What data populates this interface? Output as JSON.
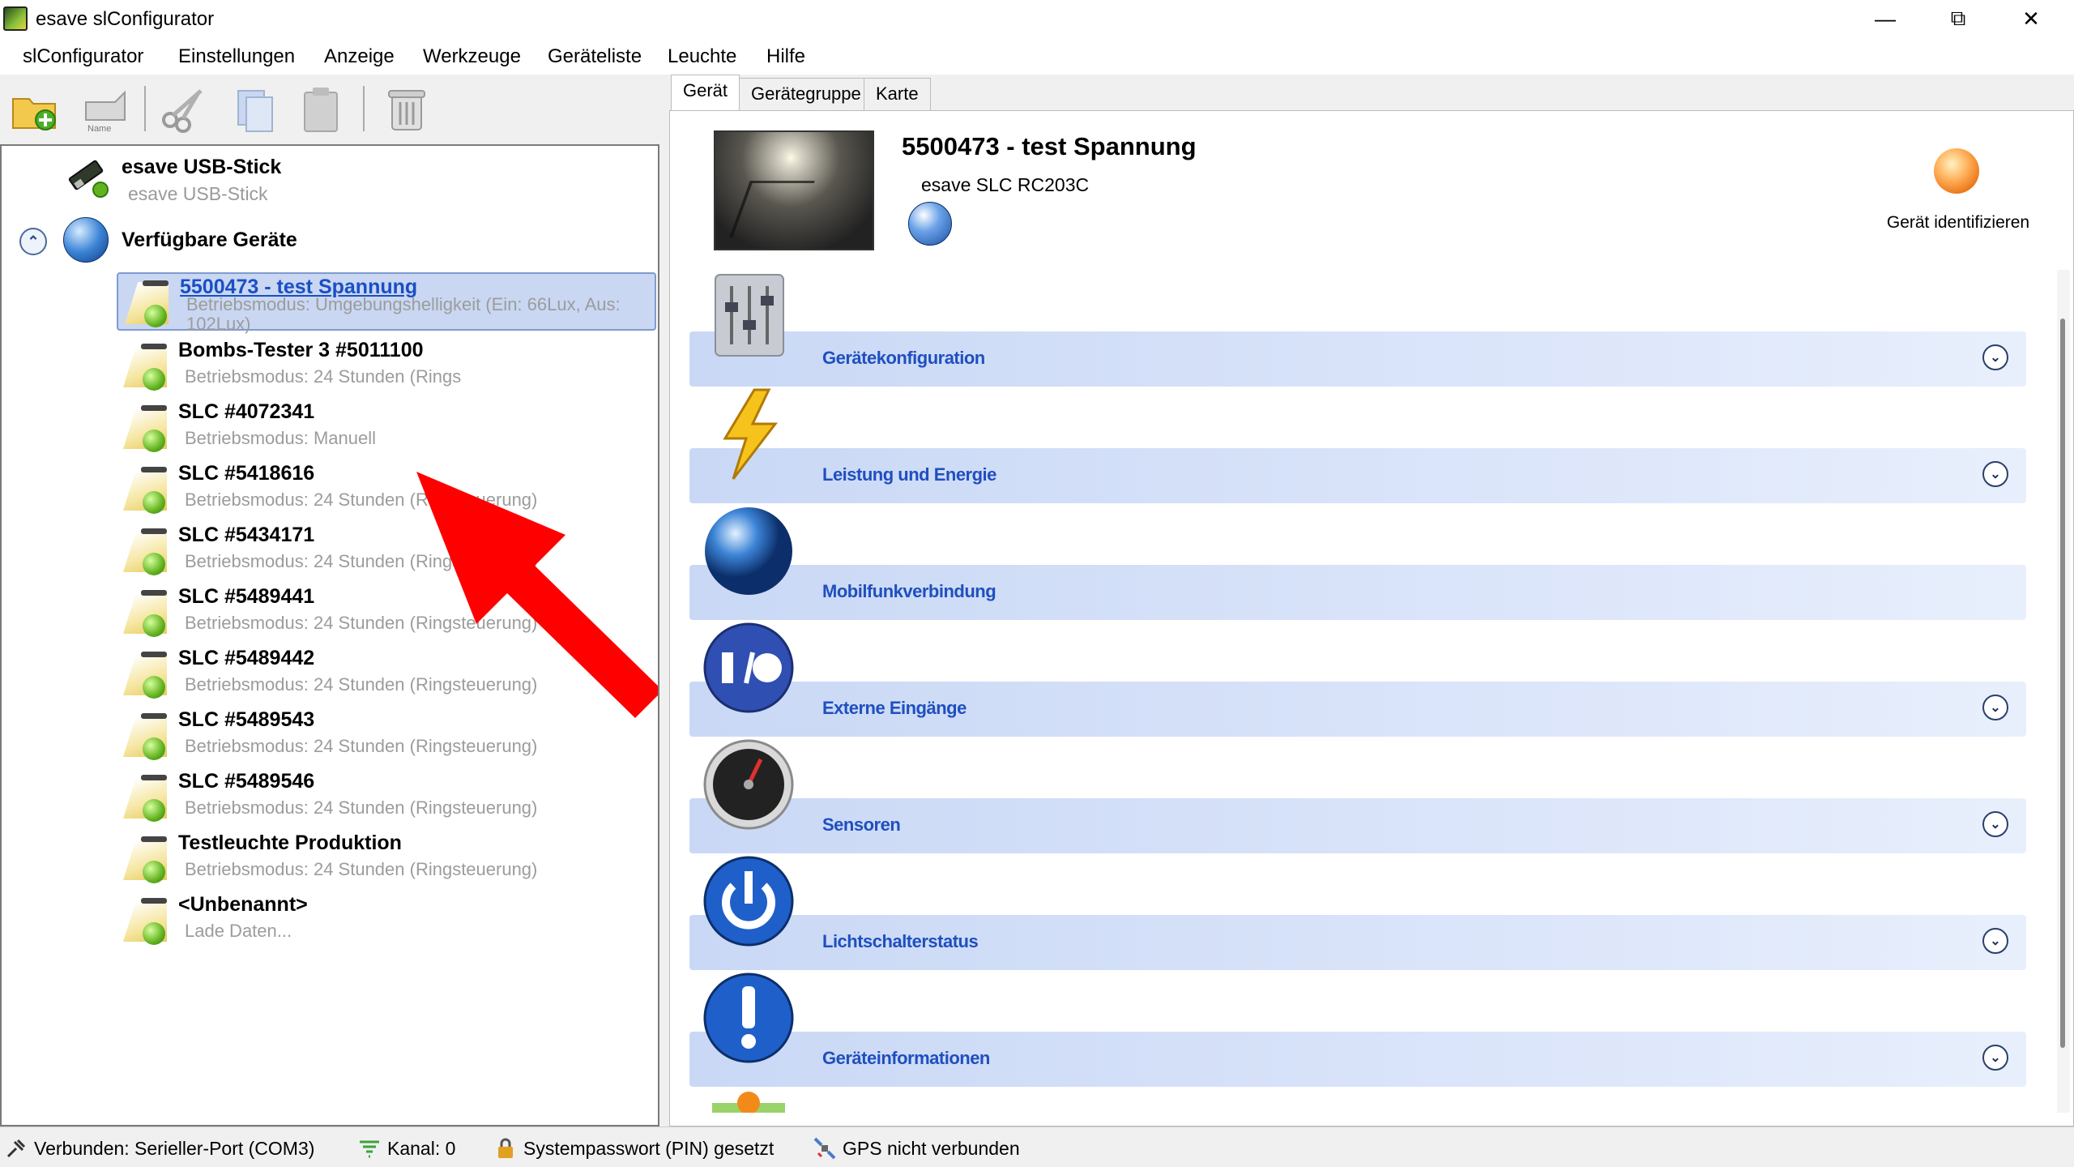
{
  "window": {
    "title": "esave slConfigurator"
  },
  "menu": [
    "slConfigurator",
    "Einstellungen",
    "Anzeige",
    "Werkzeuge",
    "Geräteliste",
    "Leuchte",
    "Hilfe"
  ],
  "toolbar": {
    "rename_label": "Name"
  },
  "tree": {
    "usb": {
      "title": "esave USB-Stick",
      "subtitle": "esave USB-Stick"
    },
    "available": {
      "title": "Verfügbare Geräte"
    },
    "devices": [
      {
        "title": "5500473 - test Spannung",
        "subtitle": "Betriebsmodus: Umgebungshelligkeit (Ein: 66Lux, Aus: 102Lux)",
        "selected": true
      },
      {
        "title": "Bombs-Tester 3 #5011100",
        "subtitle": "Betriebsmodus: 24 Stunden (Rings"
      },
      {
        "title": "SLC #4072341",
        "subtitle": "Betriebsmodus: Manuell"
      },
      {
        "title": "SLC #5418616",
        "subtitle": "Betriebsmodus: 24 Stunden (Ringsteuerung)"
      },
      {
        "title": "SLC #5434171",
        "subtitle": "Betriebsmodus: 24 Stunden (Ringsteuerung)"
      },
      {
        "title": "SLC #5489441",
        "subtitle": "Betriebsmodus: 24 Stunden (Ringsteuerung)"
      },
      {
        "title": "SLC #5489442",
        "subtitle": "Betriebsmodus: 24 Stunden (Ringsteuerung)"
      },
      {
        "title": "SLC #5489543",
        "subtitle": "Betriebsmodus: 24 Stunden (Ringsteuerung)"
      },
      {
        "title": "SLC #5489546",
        "subtitle": "Betriebsmodus: 24 Stunden (Ringsteuerung)"
      },
      {
        "title": "Testleuchte Produktion",
        "subtitle": "Betriebsmodus: 24 Stunden (Ringsteuerung)"
      },
      {
        "title": "<Unbenannt>",
        "subtitle": "Lade Daten..."
      }
    ]
  },
  "tabs": [
    "Gerät",
    "Gerätegruppe",
    "Karte"
  ],
  "device": {
    "name": "5500473 - test Spannung",
    "model": "esave SLC RC203C",
    "identify_label": "Gerät identifizieren"
  },
  "sections": [
    {
      "label": "Gerätekonfiguration",
      "icon": "sliders-icon",
      "expandable": true
    },
    {
      "label": "Leistung und Energie",
      "icon": "lightning-icon",
      "expandable": true
    },
    {
      "label": "Mobilfunkverbindung",
      "icon": "globe-icon",
      "expandable": false
    },
    {
      "label": "Externe Eingänge",
      "icon": "io-icon",
      "expandable": true
    },
    {
      "label": "Sensoren",
      "icon": "gauge-icon",
      "expandable": true
    },
    {
      "label": "Lichtschalterstatus",
      "icon": "power-icon",
      "expandable": true
    },
    {
      "label": "Geräteinformationen",
      "icon": "info-icon",
      "expandable": true
    }
  ],
  "status": {
    "connection": "Verbunden: Serieller-Port (COM3)",
    "channel": "Kanal: 0",
    "password": "Systempasswort (PIN) gesetzt",
    "gps": "GPS nicht verbunden"
  },
  "colors": {
    "accent": "#1f4fbf",
    "selection": "#c9d7f2",
    "band": "#c9d8f5",
    "annotation_arrow": "#ff0000"
  }
}
